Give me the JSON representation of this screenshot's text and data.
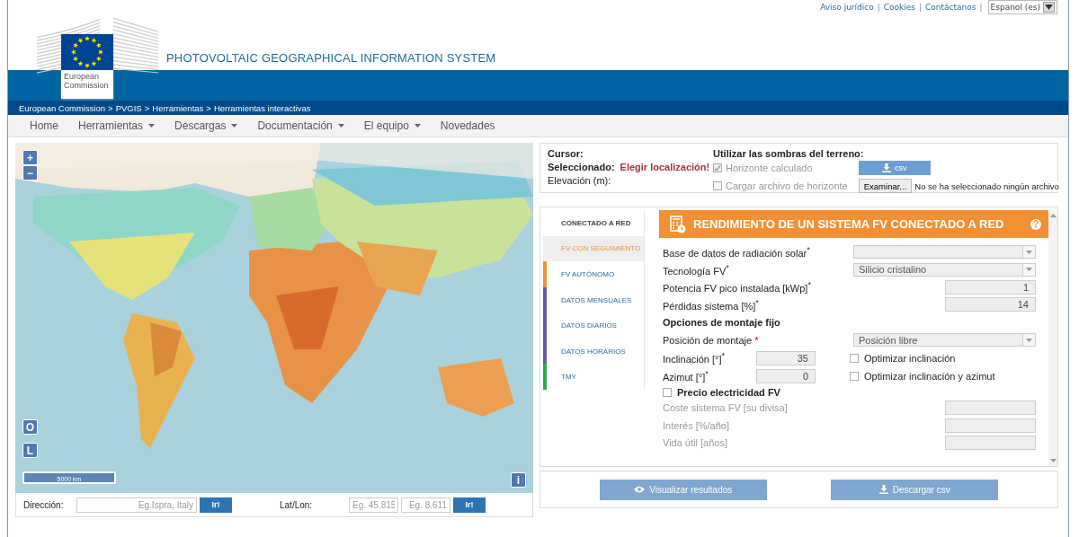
{
  "top_links": [
    "Aviso jurídico",
    "Cookies",
    "Contáctanos"
  ],
  "link_separator": "|",
  "language": {
    "value": "Espanol (es)"
  },
  "logo_caption": "European Commission",
  "site_title": "PHOTOVOLTAIC GEOGRAPHICAL INFORMATION SYSTEM",
  "breadcrumb": [
    "European Commission",
    "PVGIS",
    "Herramientas",
    "Herramientas interactivas"
  ],
  "breadcrumb_separator": ">",
  "nav": [
    {
      "label": "Home",
      "dropdown": false
    },
    {
      "label": "Herramientas",
      "dropdown": true
    },
    {
      "label": "Descargas",
      "dropdown": true
    },
    {
      "label": "Documentación",
      "dropdown": true
    },
    {
      "label": "El equipo",
      "dropdown": true
    },
    {
      "label": "Novedades",
      "dropdown": false
    }
  ],
  "map": {
    "zoom_in": "+",
    "zoom_out": "−",
    "layer_buttons": [
      "O",
      "L"
    ],
    "scale": "5000 km",
    "info": "i"
  },
  "address": {
    "label": "Dirección:",
    "placeholder": "Eg.Ispra, Italy",
    "button": "Ir!"
  },
  "latlon": {
    "label": "Lat/Lon:",
    "lat_placeholder": "Eg. 45.815",
    "lon_placeholder": "Eg. 8.611",
    "button": "Ir!"
  },
  "location_panel": {
    "cursor_label": "Cursor:",
    "selected_label": "Seleccionado:",
    "selected_value": "Elegir localización!",
    "elevation_label": "Elevación (m):",
    "shadows_title": "Utilizar las sombras del terreno:",
    "options": [
      {
        "label": "Horizonte calculado",
        "checked": true
      },
      {
        "label": "Cargar archivo de horizonte",
        "checked": false
      }
    ],
    "csv_button": "csv",
    "browse_button": "Examinar...",
    "file_status": "No se ha seleccionado ningún archivo"
  },
  "tabs": [
    {
      "label": "CONECTADO A RED",
      "selected": true,
      "highlighted": false
    },
    {
      "label": "FV CON SEGUIMIENTO",
      "selected": false,
      "highlighted": true
    },
    {
      "label": "FV AUTÓNOMO",
      "selected": false,
      "highlighted": false,
      "color": "#f39034"
    },
    {
      "label": "DATOS MENSUALES",
      "selected": false,
      "highlighted": false,
      "color": "#6a5aa6"
    },
    {
      "label": "DATOS DIARIOS",
      "selected": false,
      "highlighted": false,
      "color": "#6a5aa6"
    },
    {
      "label": "DATOS HORARIOS",
      "selected": false,
      "highlighted": false,
      "color": "#6a5aa6"
    },
    {
      "label": "TMY",
      "selected": false,
      "highlighted": false,
      "color": "#2fa84f"
    }
  ],
  "tool": {
    "title": "RENDIMIENTO DE UN SISTEMA FV CONECTADO A RED",
    "help": "?",
    "fields": [
      {
        "kind": "select",
        "label": "Base de datos de radiación solar$^{*}$"
      },
      {
        "kind": "select",
        "label": "Tecnología FV$^{*}$",
        "value": "Silicio cristalino"
      },
      {
        "kind": "number",
        "label": "Potencia FV pico instalada [kWp]$^{*}$",
        "value": "1"
      },
      {
        "kind": "number",
        "label": "Pérdidas sistema [%]$^{*}$",
        "value": "14"
      }
    ],
    "mounting_heading": "Opciones de montaje fijo",
    "position": {
      "label": "Posición de montaje",
      "required_mark": "*",
      "value": "Posición libre"
    },
    "angles": [
      {
        "label": "Inclinación [°]$^{*}$",
        "value": "35",
        "option": "Optimizar inclinación",
        "checked": false
      },
      {
        "label": "Azimut [°]$^{*}$",
        "value": "0",
        "option": "Optimizar inclinación y azimut",
        "checked": false
      }
    ],
    "price": {
      "label": "Precio electricidad FV",
      "checked": false,
      "fields": [
        "Coste sistema FV [su divisa]",
        "Interés [%/año]",
        "Vida útil [años]"
      ]
    }
  },
  "actions": [
    {
      "kind": "view",
      "label": "Visualizar resultados"
    },
    {
      "kind": "download",
      "label": "Descargar csv"
    }
  ]
}
